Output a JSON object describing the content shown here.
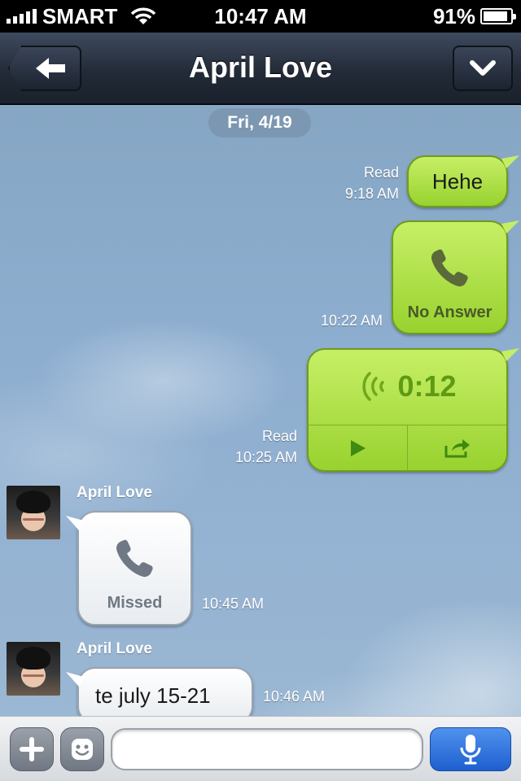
{
  "status_bar": {
    "carrier": "SMART",
    "time": "10:47 AM",
    "battery_percent": "91%",
    "battery_level": 0.91,
    "icons": [
      "signal-icon",
      "wifi-icon",
      "battery-icon"
    ]
  },
  "nav": {
    "title": "April Love",
    "back_icon": "arrow-left-icon",
    "menu_icon": "chevron-down-icon"
  },
  "chat": {
    "date": "Fri, 4/19",
    "messages": [
      {
        "side": "right",
        "type": "text",
        "text": "Hehe",
        "status": "Read",
        "time": "9:18 AM"
      },
      {
        "side": "right",
        "type": "call",
        "icon": "phone-icon",
        "label": "No Answer",
        "time": "10:22 AM"
      },
      {
        "side": "right",
        "type": "voice",
        "icon": "voice-wave-icon",
        "duration": "0:12",
        "status": "Read",
        "time": "10:25 AM",
        "actions": [
          "play-icon",
          "share-icon"
        ]
      },
      {
        "side": "left",
        "sender": "April Love",
        "type": "call",
        "icon": "phone-icon",
        "label": "Missed",
        "time": "10:45 AM"
      },
      {
        "side": "left",
        "sender": "April Love",
        "type": "text",
        "text": "te july 15-21",
        "time": "10:46 AM"
      }
    ]
  },
  "input_bar": {
    "plus_icon": "plus-icon",
    "sticker_icon": "smiley-icon",
    "message_value": "",
    "mic_icon": "microphone-icon"
  },
  "colors": {
    "bubble_green": "#a8dc3c",
    "nav_dark": "#232b38",
    "mic_blue": "#2f73e0",
    "sky": "#8eaed0"
  }
}
